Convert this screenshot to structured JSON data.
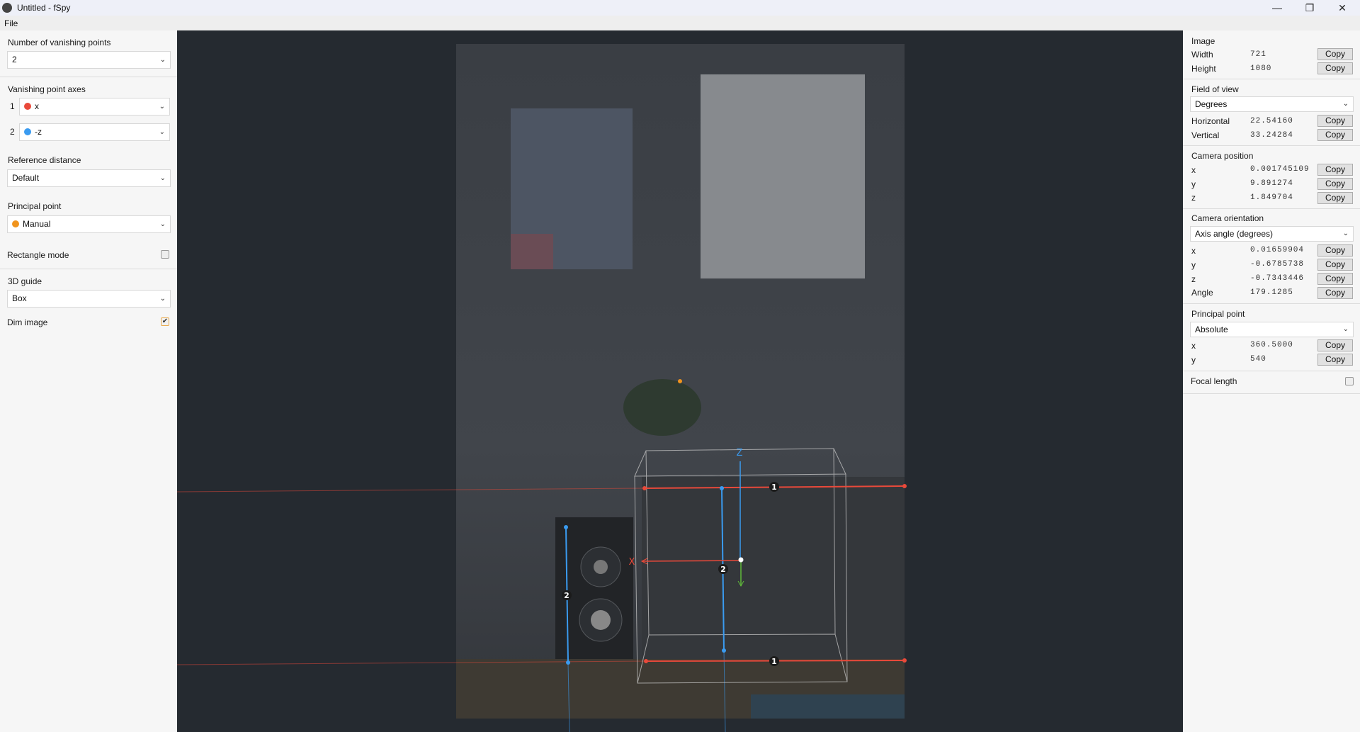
{
  "window": {
    "title": "Untitled - fSpy",
    "minimize": "—",
    "maximize": "❐",
    "close": "✕"
  },
  "menu": {
    "file": "File"
  },
  "left": {
    "num_vp_label": "Number of vanishing points",
    "num_vp_value": "2",
    "vp_axes_label": "Vanishing point axes",
    "vp_axes": [
      {
        "index": "1",
        "value": "x",
        "color": "#e9493a"
      },
      {
        "index": "2",
        "value": "-z",
        "color": "#3a9bf0"
      }
    ],
    "ref_distance_label": "Reference distance",
    "ref_distance_value": "Default",
    "principal_point_label": "Principal point",
    "principal_point_value": "Manual",
    "principal_point_color": "#f0941d",
    "rectangle_mode_label": "Rectangle mode",
    "rectangle_mode_checked": false,
    "guide_label": "3D guide",
    "guide_value": "Box",
    "dim_image_label": "Dim image",
    "dim_image_checked": true
  },
  "right": {
    "image": {
      "title": "Image",
      "width_label": "Width",
      "width": "721",
      "height_label": "Height",
      "height": "1080"
    },
    "fov": {
      "title": "Field of view",
      "unit": "Degrees",
      "horizontal_label": "Horizontal",
      "horizontal": "22.54160",
      "vertical_label": "Vertical",
      "vertical": "33.24284"
    },
    "cam_pos": {
      "title": "Camera position",
      "x": "0.001745109",
      "y": "9.891274",
      "z": "1.849704"
    },
    "cam_orient": {
      "title": "Camera orientation",
      "mode": "Axis angle (degrees)",
      "x": "0.01659904",
      "y": "-0.6785738",
      "z": "-0.7343446",
      "angle_label": "Angle",
      "angle": "179.1285"
    },
    "pp": {
      "title": "Principal point",
      "mode": "Absolute",
      "x": "360.5000",
      "y": "540"
    },
    "focal": {
      "title": "Focal length",
      "checked": false
    },
    "axis_labels": {
      "x": "x",
      "y": "y",
      "z": "z"
    },
    "copy_label": "Copy"
  },
  "overlay": {
    "vp1_label": "1",
    "vp2_label": "2",
    "axis_x": "X",
    "axis_z": "Z",
    "colors": {
      "vp1": "#e9493a",
      "vp2": "#3a9bf0",
      "y_axis": "#5fb83a",
      "pp": "#f0941d"
    }
  }
}
